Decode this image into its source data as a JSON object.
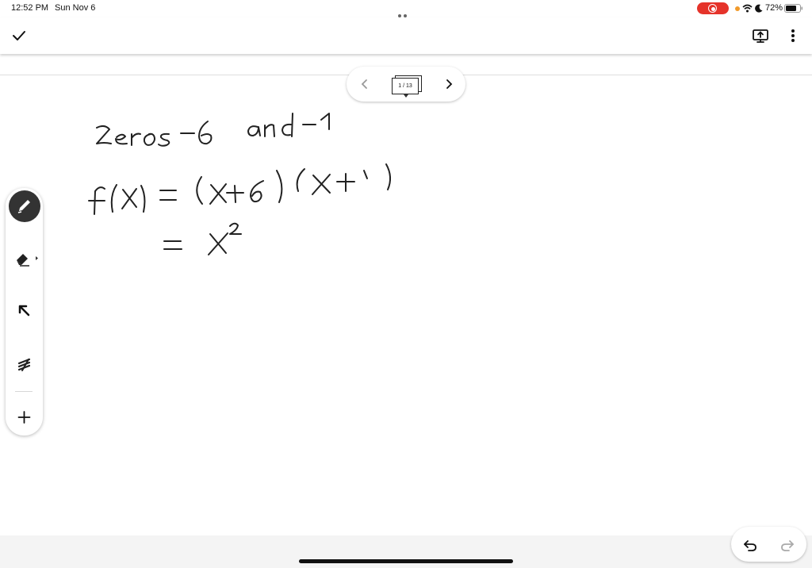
{
  "status_bar": {
    "time": "12:52 PM",
    "date": "Sun Nov 6",
    "battery": "72%"
  },
  "page_nav": {
    "page_label": "1 / 13"
  },
  "handwriting": {
    "line1": "zeros -6 and -1",
    "line2": "f(x) = (x+6)(x+1)",
    "line3": "= x^2"
  },
  "icons": {
    "confirm": "check-icon",
    "present": "present-icon",
    "more": "more-vertical-icon",
    "prev": "chevron-left-icon",
    "next": "chevron-right-icon",
    "pen": "pen-icon",
    "eraser": "eraser-icon",
    "select": "arrow-select-icon",
    "laser": "laser-pointer-icon",
    "add": "plus-icon",
    "undo": "undo-icon",
    "redo": "redo-icon"
  },
  "colors": {
    "recording": "#e5332a",
    "ink": "#222222",
    "active_tool": "#333333"
  }
}
